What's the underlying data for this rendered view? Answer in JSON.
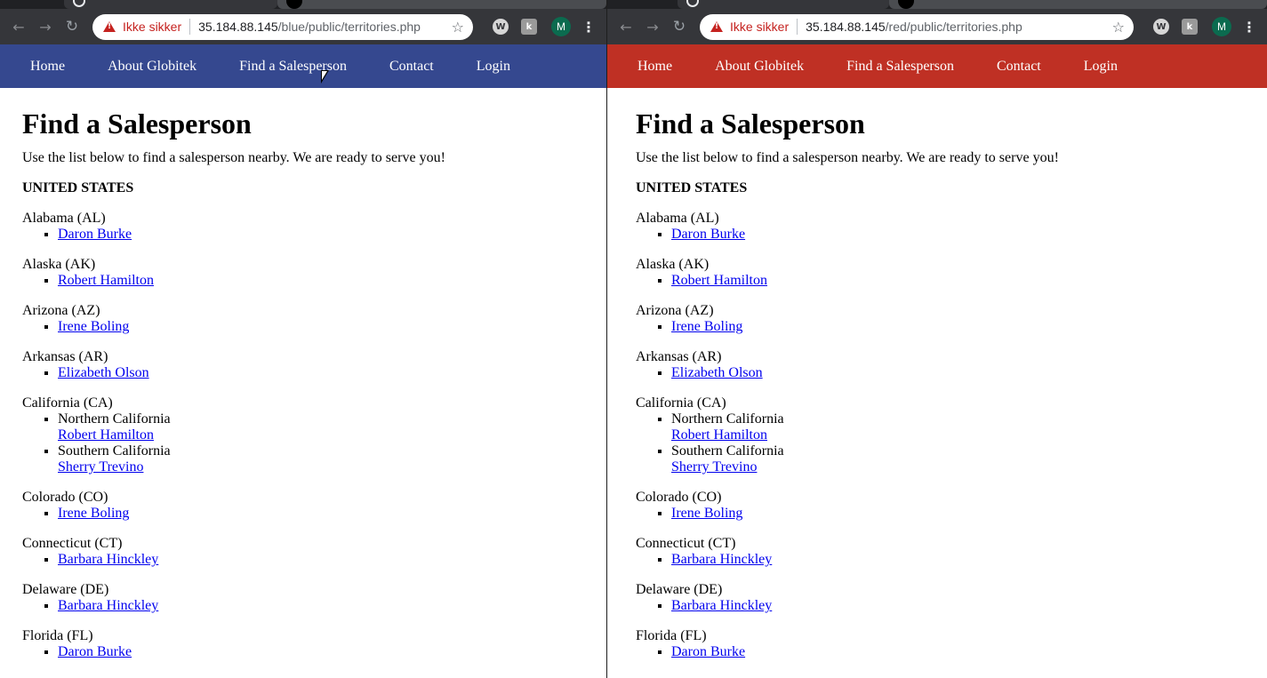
{
  "browser": {
    "not_secure_label": "Ikke sikker",
    "avatar_initial": "M",
    "ext1_label": "W",
    "ext2_label": "k"
  },
  "left": {
    "theme_color": "#35488f",
    "url_host": "35.184.88.145",
    "url_path": "/blue/public/territories.php"
  },
  "right": {
    "theme_color": "#bf3024",
    "url_host": "35.184.88.145",
    "url_path": "/red/public/territories.php"
  },
  "nav": [
    "Home",
    "About Globitek",
    "Find a Salesperson",
    "Contact",
    "Login"
  ],
  "page": {
    "title": "Find a Salesperson",
    "intro": "Use the list below to find a salesperson nearby. We are ready to serve you!",
    "country": "UNITED STATES",
    "states": [
      {
        "name": "Alabama (AL)",
        "territories": [
          {
            "region": "",
            "person": "Daron Burke"
          }
        ]
      },
      {
        "name": "Alaska (AK)",
        "territories": [
          {
            "region": "",
            "person": "Robert Hamilton"
          }
        ]
      },
      {
        "name": "Arizona (AZ)",
        "territories": [
          {
            "region": "",
            "person": "Irene Boling"
          }
        ]
      },
      {
        "name": "Arkansas (AR)",
        "territories": [
          {
            "region": "",
            "person": "Elizabeth Olson"
          }
        ]
      },
      {
        "name": "California (CA)",
        "territories": [
          {
            "region": "Northern California",
            "person": "Robert Hamilton"
          },
          {
            "region": "Southern California",
            "person": "Sherry Trevino"
          }
        ]
      },
      {
        "name": "Colorado (CO)",
        "territories": [
          {
            "region": "",
            "person": "Irene Boling"
          }
        ]
      },
      {
        "name": "Connecticut (CT)",
        "territories": [
          {
            "region": "",
            "person": "Barbara Hinckley"
          }
        ]
      },
      {
        "name": "Delaware (DE)",
        "territories": [
          {
            "region": "",
            "person": "Barbara Hinckley"
          }
        ]
      },
      {
        "name": "Florida (FL)",
        "territories": [
          {
            "region": "",
            "person": "Daron Burke"
          }
        ]
      }
    ]
  }
}
